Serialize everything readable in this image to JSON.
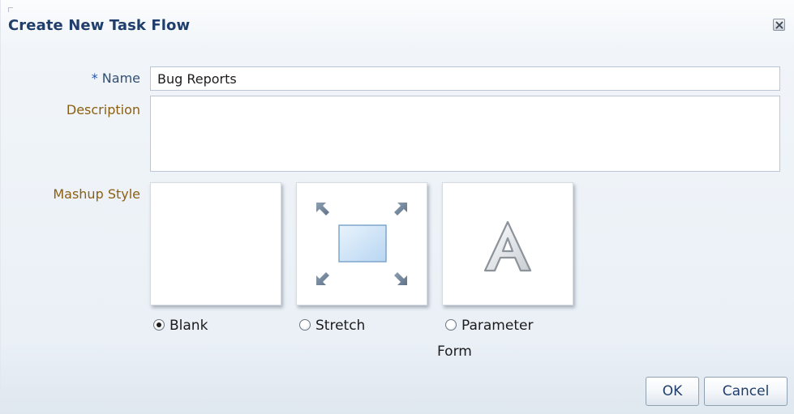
{
  "dialog": {
    "title": "Create New Task Flow",
    "close_icon": "close-icon"
  },
  "form": {
    "name": {
      "required_marker": "*",
      "label": "Name",
      "value": "Bug Reports"
    },
    "description": {
      "label": "Description",
      "value": ""
    },
    "mashup_style": {
      "label": "Mashup Style",
      "selected": "Blank",
      "options": [
        {
          "label": "Blank",
          "icon": "blank-layout-icon",
          "selected": true
        },
        {
          "label": "Stretch",
          "icon": "stretch-layout-icon",
          "selected": false
        },
        {
          "label_line1": "Parameter",
          "label_line2": "Form",
          "icon": "parameter-form-icon",
          "selected": false
        }
      ]
    }
  },
  "buttons": {
    "ok_label": "OK",
    "cancel_label": "Cancel"
  },
  "colors": {
    "title": "#1f3e6b",
    "label": "#8a5f12",
    "required": "#2457a6",
    "input_border": "#b9c7d6"
  }
}
